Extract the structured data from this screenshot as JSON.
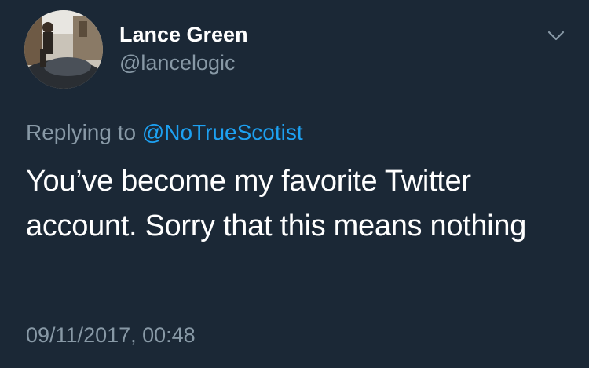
{
  "user": {
    "display_name": "Lance Green",
    "handle": "@lancelogic",
    "avatar_icon": "user-avatar-photo"
  },
  "header": {
    "menu_icon": "chevron-down-icon"
  },
  "reply": {
    "prefix": "Replying to",
    "mention": "@NoTrueScotist"
  },
  "tweet": {
    "text": "You’ve become my favorite Twitter account. Sorry that this means nothing",
    "timestamp": "09/11/2017, 00:48"
  },
  "colors": {
    "background": "#1b2836",
    "primary_text": "#ffffff",
    "secondary_text": "#8899a6",
    "link": "#1da1f2"
  }
}
